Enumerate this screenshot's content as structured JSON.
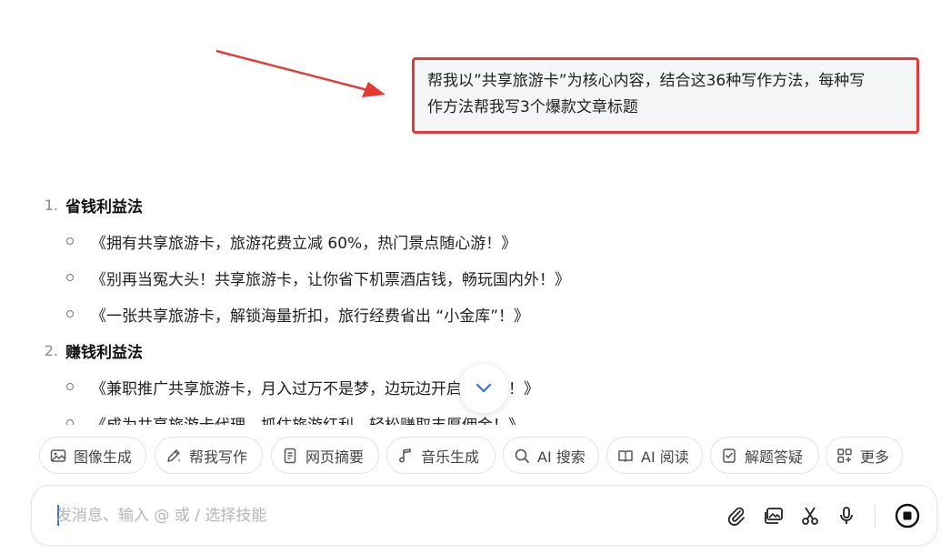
{
  "user_message": {
    "line1": "帮我以”共享旅游卡”为核心内容，结合这36种写作方法，每种写",
    "line2": "作方法帮我写3个爆款文章标题"
  },
  "answer": {
    "sections": [
      {
        "number": "1.",
        "title": "省钱利益法",
        "items": [
          "《拥有共享旅游卡，旅游花费立减 60%，热门景点随心游！》",
          "《别再当冤大头！共享旅游卡，让你省下机票酒店钱，畅玩国内外！》",
          "《一张共享旅游卡，解锁海量折扣，旅行经费省出 “小金库”！》"
        ]
      },
      {
        "number": "2.",
        "title": "赚钱利益法",
        "items": [
          "《兼职推广共享旅游卡，月入过万不是梦，边玩边开启新事业！》",
          "《成为共享旅游卡代理，抓住旅游红利，轻松赚取丰厚佣金！》"
        ]
      }
    ]
  },
  "skills": [
    {
      "label": "图像生成",
      "icon": "image-icon"
    },
    {
      "label": "帮我写作",
      "icon": "pen-icon"
    },
    {
      "label": "网页摘要",
      "icon": "document-icon"
    },
    {
      "label": "音乐生成",
      "icon": "music-icon"
    },
    {
      "label": "AI 搜索",
      "icon": "search-icon"
    },
    {
      "label": "AI 阅读",
      "icon": "reading-icon"
    },
    {
      "label": "解题答疑",
      "icon": "solve-icon"
    },
    {
      "label": "更多",
      "icon": "grid-icon"
    }
  ],
  "input": {
    "placeholder": "发消息、输入 @ 或 / 选择技能"
  },
  "colors": {
    "highlight_border": "#e53935",
    "accent": "#3a6df0"
  }
}
